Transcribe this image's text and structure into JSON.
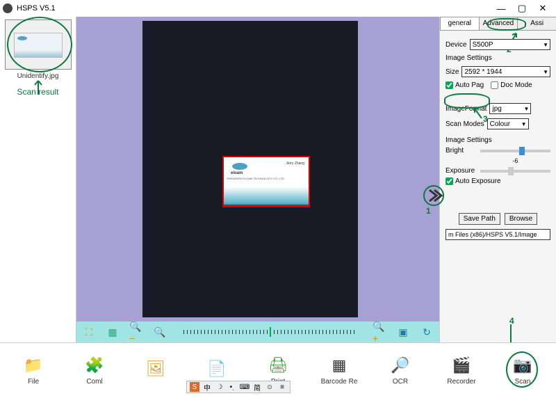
{
  "title": "HSPS V5.1",
  "window_controls": {
    "min": "—",
    "max": "▢",
    "close": "✕"
  },
  "left": {
    "thumbnail_filename": "Unidentify.jpg",
    "scan_result_label": "Scan result"
  },
  "center": {
    "card": {
      "brand": "eloam",
      "person": "Jerry Zhang",
      "company": "SHENZHEN ELOAM TECHNOLOGY CO.,LTD."
    },
    "toolbar": {
      "crop": "⛶",
      "fit": "▦",
      "zoom_out_full": "🔍−",
      "zoom_out": "🔍",
      "zoom_in": "🔍+",
      "focus": "▣",
      "rotate": "↻"
    }
  },
  "right": {
    "tabs": {
      "general": "general",
      "advanced": "Advanced",
      "assi": "Assi"
    },
    "device_label": "Device",
    "device_value": "S500P",
    "image_settings_label": "Image Settings",
    "size_label": "Size",
    "size_value": "2592 * 1944",
    "auto_page_label": "Auto Pag",
    "auto_page_checked": true,
    "doc_mode_label": "Doc Mode",
    "doc_mode_checked": false,
    "image_format_label": "ImageFormat",
    "image_format_value": "jpg",
    "scan_modes_label": "Scan Modes",
    "scan_modes_value": "Colour",
    "image_settings2_label": "Image Settings",
    "bright_label": "Bright",
    "bright_value": "-6",
    "exposure_label": "Exposure",
    "auto_exposure_label": "Auto Exposure",
    "auto_exposure_checked": true,
    "save_path_btn": "Save Path",
    "browse_btn": "Browse",
    "path_value": "m Files (x86)/HSPS V5.1/Image"
  },
  "bottom": {
    "file": "File",
    "combine": "Coml",
    "slideshow": "",
    "pdf": "",
    "print": "Print",
    "barcode": "Barcode Re",
    "ocr": "OCR",
    "recorder": "Recorder",
    "scan": "Scan"
  },
  "annotations": {
    "n1": "1",
    "n2": "2",
    "n3": "3",
    "n4": "4"
  },
  "ime": {
    "lang": "中",
    "moon": "☽",
    "punct": "•ˌ",
    "key": "⌨",
    "simp": "简",
    "face": "☺"
  }
}
